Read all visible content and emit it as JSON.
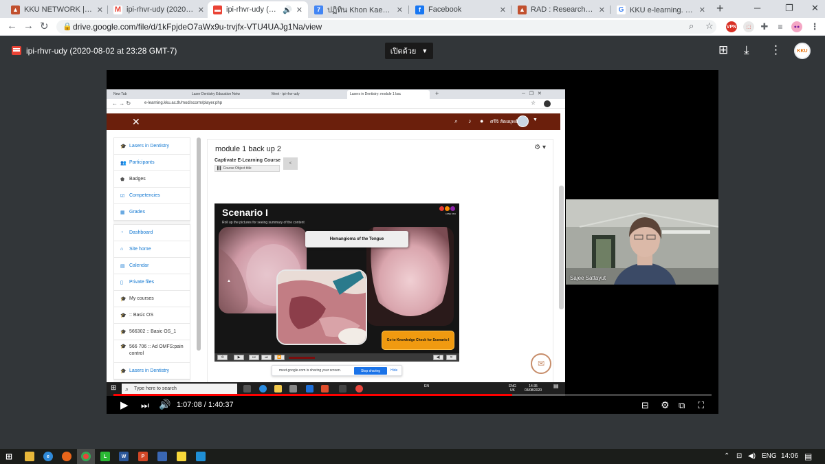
{
  "browser": {
    "tabs": [
      {
        "title": "KKU NETWORK | Status",
        "icon": "flame-icon",
        "color": "#c1502e"
      },
      {
        "title": "ipi-rhvr-udy (2020-08-02",
        "icon": "gmail-icon",
        "color": "#ea4335"
      },
      {
        "title": "ipi-rhvr-udy (2020-0",
        "icon": "video-file-icon",
        "color": "#ea4335",
        "active": true
      },
      {
        "title": "ปฏิทิน Khon Kaen Univers",
        "icon": "calendar-icon",
        "color": "#4285f4"
      },
      {
        "title": "Facebook",
        "icon": "facebook-icon",
        "color": "#1877f2"
      },
      {
        "title": "RAD : Research Administ",
        "icon": "flame-icon",
        "color": "#c1502e"
      },
      {
        "title": "KKU e-learning. - ค้นหาด้",
        "icon": "google-icon",
        "color": "#4285f4"
      }
    ],
    "url": "drive.google.com/file/d/1kFpjdeO7aWx9u-trvjfx-VTU4UAJg1Na/view"
  },
  "viewer": {
    "file_title": "ipi-rhvr-udy (2020-08-02 at 23:28 GMT-7)",
    "open_with_label": "เปิดด้วย",
    "avatar_text": "KKU"
  },
  "recording": {
    "inner_tabs": [
      "New Tab",
      "Laser Dentistry Education Netw",
      "Meet - ipi-rhvr-udy",
      "Lasers in Dentistry: module 1 bac"
    ],
    "inner_url": "e-learning.kku.ac.th/mod/scorm/player.php",
    "moodle_user": "ศรีจิ สัตยยุทธ์",
    "drawer": {
      "group1": [
        {
          "label": "Lasers in Dentistry",
          "icon": "graduation-cap-icon"
        },
        {
          "label": "Participants",
          "icon": "users-icon"
        },
        {
          "label": "Badges",
          "icon": "shield-icon"
        },
        {
          "label": "Competencies",
          "icon": "check-square-icon"
        },
        {
          "label": "Grades",
          "icon": "table-icon"
        }
      ],
      "group2": [
        {
          "label": "Dashboard",
          "icon": "dashboard-icon"
        },
        {
          "label": "Site home",
          "icon": "home-icon"
        },
        {
          "label": "Calendar",
          "icon": "calendar-icon"
        },
        {
          "label": "Private files",
          "icon": "file-icon"
        },
        {
          "label": "My courses",
          "icon": "graduation-cap-icon"
        },
        {
          "label": ":: Basic OS",
          "icon": "graduation-cap-icon"
        },
        {
          "label": "566302 :: Basic OS_1",
          "icon": "graduation-cap-icon"
        },
        {
          "label": "566 706 :: Ad OMFS:pain control",
          "icon": "graduation-cap-icon"
        },
        {
          "label": "Lasers in Dentistry",
          "icon": "graduation-cap-icon"
        }
      ]
    },
    "course_title": "module 1 back up 2",
    "captivate_title": "Captivate E-Learning Course",
    "course_object_title": "Course Object title",
    "scenario_title": "Scenario I",
    "scenario_subtitle": "Roll up the pictures for seeing summary of the content",
    "logo_caption": "LDNE  KKU",
    "image_label": "Hemangioma of the Tongue",
    "knowledge_button": "Go to Knowledge Check for Scenario I",
    "share_message": "meet.google.com is sharing your screen.",
    "stop_sharing": "Stop sharing",
    "hide": "Hide",
    "search_placeholder": "Type here to search",
    "tray_lang": "EN",
    "tray_ime": "ENG\nUK",
    "tray_time": "14:35",
    "tray_date": "03/08/2020"
  },
  "camera": {
    "participant_name": "Sajee Sattayut"
  },
  "player": {
    "current_time": "1:07:08",
    "duration": "1:40:37",
    "time_separator": " / ",
    "progress_fraction": 0.667
  },
  "taskbar": {
    "lang": "ENG",
    "time": "14:06"
  }
}
